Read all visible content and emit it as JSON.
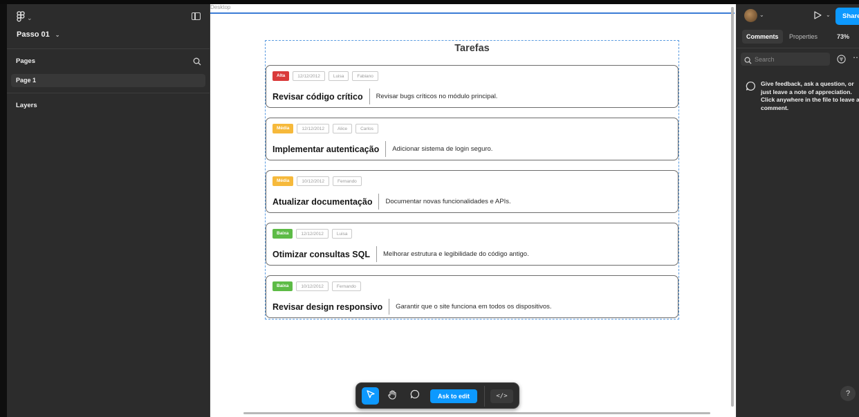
{
  "project": {
    "name": "Passo 01"
  },
  "pages": {
    "heading": "Pages",
    "items": [
      {
        "label": "Page 1"
      }
    ]
  },
  "layers": {
    "heading": "Layers"
  },
  "canvas": {
    "frame_label": "Desktop"
  },
  "board": {
    "title": "Tarefas",
    "tasks": [
      {
        "priority": "Alta",
        "priority_color": "#d93a3a",
        "date": "12/12/2012",
        "assignees": [
          "Luisa",
          "Fabiano"
        ],
        "title": "Revisar código crítico",
        "description": "Revisar bugs críticos no módulo principal."
      },
      {
        "priority": "Média",
        "priority_color": "#f6b93b",
        "date": "12/12/2012",
        "assignees": [
          "Alice",
          "Carlos"
        ],
        "title": "Implementar autenticação",
        "description": "Adicionar sistema de login seguro."
      },
      {
        "priority": "Média",
        "priority_color": "#f6b93b",
        "date": "10/12/2012",
        "assignees": [
          "Fernando"
        ],
        "title": "Atualizar documentação",
        "description": "Documentar novas funcionalidades e APIs."
      },
      {
        "priority": "Baixa",
        "priority_color": "#5dbb46",
        "date": "12/12/2012",
        "assignees": [
          "Luisa"
        ],
        "title": "Otimizar consultas SQL",
        "description": "Melhorar estrutura e legibilidade do código antigo."
      },
      {
        "priority": "Baixa",
        "priority_color": "#5dbb46",
        "date": "10/12/2012",
        "assignees": [
          "Fernando"
        ],
        "title": "Revisar design responsivo",
        "description": "Garantir que o site funciona em todos os dispositivos."
      }
    ]
  },
  "toolbar": {
    "ask_to_edit": "Ask to edit",
    "code_label": "</>",
    "icons": [
      "cursor-icon",
      "hand-icon",
      "comment-icon"
    ]
  },
  "right_panel": {
    "share_label": "Share",
    "tabs": [
      "Comments",
      "Properties"
    ],
    "zoom": "73%",
    "search_placeholder": "Search",
    "comment_hint": "Give feedback, ask a question, or just leave a note of appreciation. Click anywhere in the file to leave a comment.",
    "help_label": "?"
  },
  "colors": {
    "accent": "#0d99ff",
    "panel": "#2c2c2c",
    "selection": "#3a7bd5"
  }
}
